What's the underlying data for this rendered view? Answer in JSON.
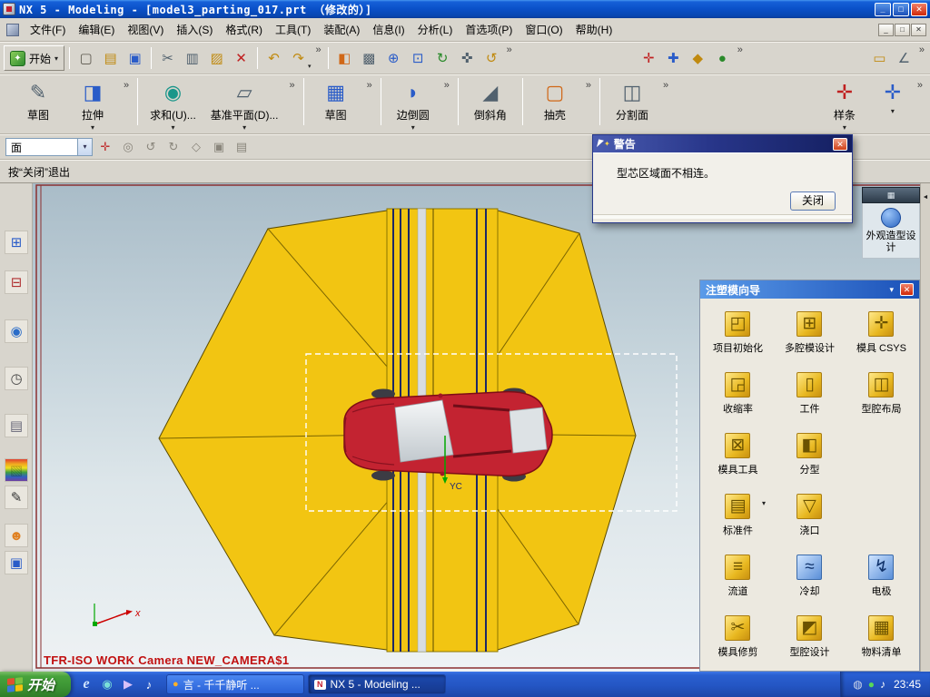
{
  "titlebar": {
    "title": "NX 5 - Modeling - [model3_parting_017.prt （修改的）]",
    "buttons": {
      "minimize": "_",
      "restore": "□",
      "close": "✕"
    }
  },
  "menubar": {
    "items": [
      "文件(F)",
      "编辑(E)",
      "视图(V)",
      "插入(S)",
      "格式(R)",
      "工具(T)",
      "装配(A)",
      "信息(I)",
      "分析(L)",
      "首选项(P)",
      "窗口(O)",
      "帮助(H)"
    ],
    "window_buttons": {
      "minimize": "_",
      "restore": "□",
      "close": "✕"
    }
  },
  "toolbar_standard": {
    "start": {
      "label": "开始",
      "glyph": "✦",
      "caret": "▾"
    },
    "chevron": "»",
    "icons": [
      {
        "name": "new-file-icon",
        "glyph": "▢"
      },
      {
        "name": "open-file-icon",
        "glyph": "▤"
      },
      {
        "name": "save-icon",
        "glyph": "▣"
      },
      {
        "name": "cut-icon",
        "glyph": "✂"
      },
      {
        "name": "copy-icon",
        "glyph": "▥"
      },
      {
        "name": "paste-icon",
        "glyph": "▨"
      },
      {
        "name": "delete-icon",
        "glyph": "✕"
      },
      {
        "name": "undo-icon",
        "glyph": "↶"
      },
      {
        "name": "redo-icon",
        "glyph": "↷"
      },
      {
        "name": "orient-view-icon",
        "glyph": "◧"
      },
      {
        "name": "shaded-view-icon",
        "glyph": "▩"
      },
      {
        "name": "zoom-in-icon",
        "glyph": "⊕"
      },
      {
        "name": "zoom-window-icon",
        "glyph": "⊡"
      },
      {
        "name": "refresh-view-icon",
        "glyph": "↻"
      },
      {
        "name": "pan-view-icon",
        "glyph": "✜"
      },
      {
        "name": "rotate-view-icon",
        "glyph": "↺"
      },
      {
        "name": "csys-icon",
        "glyph": "✛"
      },
      {
        "name": "datum-icon",
        "glyph": "✚"
      },
      {
        "name": "snap-point-icon",
        "glyph": "◆"
      },
      {
        "name": "snap-end-icon",
        "glyph": "●"
      },
      {
        "name": "measure-icon",
        "glyph": "▭"
      },
      {
        "name": "angle-icon",
        "glyph": "∠"
      }
    ]
  },
  "toolbar_features": {
    "chevron": "»",
    "caret": "▾",
    "items": [
      {
        "name": "sketch-button",
        "label": "草图",
        "glyph": "✎"
      },
      {
        "name": "extrude-button",
        "label": "拉伸",
        "glyph": "◨"
      },
      {
        "name": "unite-button",
        "label": "求和(U)...",
        "glyph": "◉"
      },
      {
        "name": "datum-plane-button",
        "label": "基准平面(D)...",
        "glyph": "▱"
      },
      {
        "name": "sketch2-button",
        "label": "草图",
        "glyph": "▦"
      },
      {
        "name": "edge-blend-button",
        "label": "边倒圆",
        "glyph": "◗"
      },
      {
        "name": "chamfer-button",
        "label": "倒斜角",
        "glyph": "◢"
      },
      {
        "name": "shell-button",
        "label": "抽壳",
        "glyph": "▢"
      },
      {
        "name": "divide-face-button",
        "label": "分割面",
        "glyph": "◫"
      },
      {
        "name": "spline-button",
        "label": "样条",
        "glyph": "✛"
      }
    ],
    "trailing_icon": {
      "name": "csys-mini-icon",
      "glyph": "✛"
    }
  },
  "selection_bar": {
    "filter_value": "面",
    "caret": "▾",
    "icons": [
      {
        "name": "snap-cross-icon",
        "glyph": "✛"
      },
      {
        "name": "general-select-icon",
        "glyph": "◎"
      },
      {
        "name": "prev-selection-icon",
        "glyph": "↺"
      },
      {
        "name": "next-selection-icon",
        "glyph": "↻"
      },
      {
        "name": "face-rule-icon",
        "glyph": "◇"
      },
      {
        "name": "solid-select-icon",
        "glyph": "▣"
      },
      {
        "name": "sheet-select-icon",
        "glyph": "▤"
      }
    ]
  },
  "prompt_bar": {
    "text": "按“关闭”退出"
  },
  "left_rail": {
    "icons": [
      {
        "name": "assembly-navigator-icon",
        "glyph": "⊞"
      },
      {
        "name": "constraint-navigator-icon",
        "glyph": "⊟"
      },
      {
        "name": "web-browser-icon",
        "glyph": "◉"
      },
      {
        "name": "history-icon",
        "glyph": "◷"
      },
      {
        "name": "part-navigator-icon",
        "glyph": "▤"
      },
      {
        "name": "palette-icon",
        "glyph": "▧"
      },
      {
        "name": "sketcher-icon",
        "glyph": "✎"
      },
      {
        "name": "roles-icon",
        "glyph": "☻"
      },
      {
        "name": "system-window-icon",
        "glyph": "▣"
      }
    ]
  },
  "viewport": {
    "view_label": "TFR-ISO WORK Camera NEW_CAMERA$1",
    "yc_label": "YC",
    "x_axis_label": "x"
  },
  "resource_strip": {
    "label": "外观造型设计",
    "header_glyph": "▦"
  },
  "mold_wizard": {
    "title": "注塑模向导",
    "caret": "▾",
    "close_glyph": "✕",
    "dropdown_glyph": "▾",
    "items": [
      {
        "name": "project-init",
        "label": "项目初始化",
        "glyph": "◰"
      },
      {
        "name": "multi-cavity",
        "label": "多腔模设计",
        "glyph": "⊞"
      },
      {
        "name": "mold-csys",
        "label": "模具 CSYS",
        "glyph": "✛"
      },
      {
        "name": "shrinkage",
        "label": "收缩率",
        "glyph": "◲"
      },
      {
        "name": "workpiece",
        "label": "工件",
        "glyph": "▯"
      },
      {
        "name": "cavity-layout",
        "label": "型腔布局",
        "glyph": "◫"
      },
      {
        "name": "mold-tools",
        "label": "模具工具",
        "glyph": "⊠"
      },
      {
        "name": "parting",
        "label": "分型",
        "glyph": "◧"
      },
      {
        "name": "standard-parts",
        "label": "标准件",
        "glyph": "▤"
      },
      {
        "name": "gate",
        "label": "浇口",
        "glyph": "▽"
      },
      {
        "name": "runner",
        "label": "流道",
        "glyph": "≡"
      },
      {
        "name": "cooling",
        "label": "冷却",
        "glyph": "≈"
      },
      {
        "name": "electrode",
        "label": "电极",
        "glyph": "↯"
      },
      {
        "name": "mold-trim",
        "label": "模具修剪",
        "glyph": "✂"
      },
      {
        "name": "cavity-design",
        "label": "型腔设计",
        "glyph": "◩"
      },
      {
        "name": "bom",
        "label": "物料清单",
        "glyph": "▦"
      }
    ]
  },
  "warning_dialog": {
    "title": "警告",
    "message": "型芯区域面不相连。",
    "close_button": "关闭",
    "close_glyph": "✕",
    "star_glyph": "✦"
  },
  "taskbar": {
    "start_label": "开始",
    "quick_launch": [
      {
        "name": "ie-icon",
        "glyph": "e"
      },
      {
        "name": "media-icon",
        "glyph": "◉"
      },
      {
        "name": "player-icon",
        "glyph": "▶"
      },
      {
        "name": "music-icon",
        "glyph": "♪"
      }
    ],
    "tasks": [
      {
        "name": "task-ttplayer",
        "label": "言 - 千千静听  ...",
        "glyph": "●"
      },
      {
        "name": "task-nx",
        "label": "NX 5 - Modeling ...",
        "glyph": "N"
      }
    ],
    "tray_icons": [
      {
        "name": "tray-network-icon",
        "glyph": "◍"
      },
      {
        "name": "tray-shield-icon",
        "glyph": "●"
      },
      {
        "name": "tray-volume-icon",
        "glyph": "♪"
      }
    ],
    "clock": "23:45"
  },
  "colors": {
    "titlebar_blue": "#0a50c8",
    "parting_yellow": "#f2c512",
    "car_red": "#c32331",
    "taskbar_blue": "#2456c4",
    "view_border_maroon": "#8b3030"
  }
}
